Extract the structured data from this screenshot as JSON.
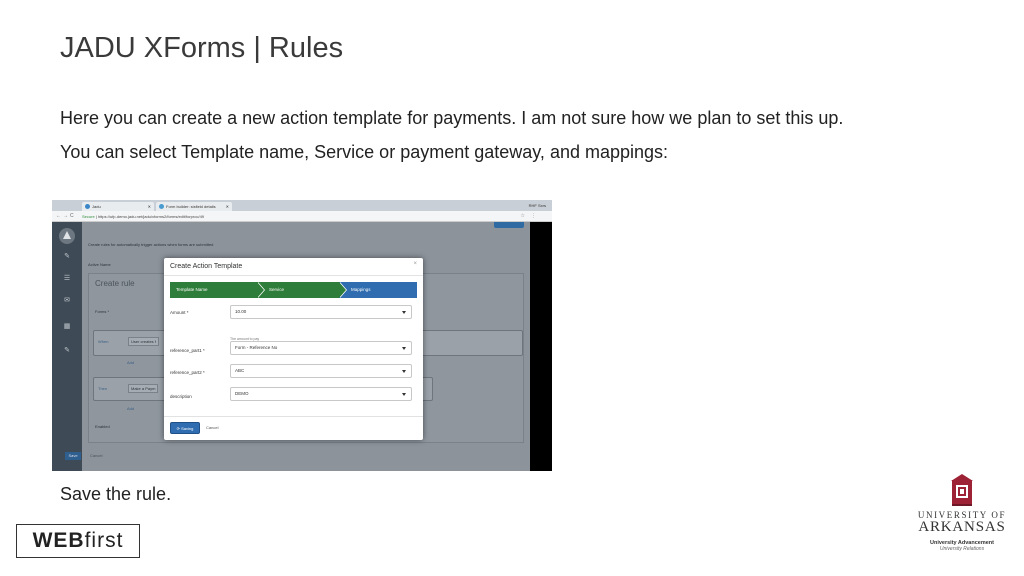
{
  "slide": {
    "title": "JADU XForms | Rules",
    "line1": "Here you can create a new action template for payments. I am not sure how we plan to set this up.",
    "line2": "You can select Template name, Service or payment gateway, and mappings:",
    "save_text": "Save the rule."
  },
  "branding": {
    "webfirst_bold": "WEB",
    "webfirst_light": "first",
    "ua_university": "UNIVERSITY OF",
    "ua_arkansas": "ARKANSAS",
    "ua_sub1": "University Advancement",
    "ua_sub2": "University Relations",
    "accent_red": "#9d2235"
  },
  "browser": {
    "tabs": [
      {
        "label": "Jadu",
        "favicon_color": "#3a86c8"
      },
      {
        "label": "Form builder: sisfield details",
        "favicon_color": "#4a9bd0"
      }
    ],
    "user": "RHF Sxrs",
    "secure_label": "Secure",
    "url": "https://ufp-demo.jadu.net/jadu/xforms2/forms/edit/forproc/49"
  },
  "app": {
    "description": "Create rules for automatically trigger actions when forms are submitted",
    "tabs": "Active   Name",
    "create_rule": "Create rule",
    "forms_label": "Forms *",
    "when_label": "When",
    "when_value": "User creates f",
    "add1": "Add",
    "then_label": "Then",
    "then_value": "Make a Paym",
    "add2": "Add",
    "enabled_label": "Enabled",
    "save": "Save",
    "cancel": "Cancel"
  },
  "modal": {
    "title": "Create Action Template",
    "close": "×",
    "steps": [
      "Template Name",
      "Service",
      "Mappings"
    ],
    "fields": [
      {
        "label": "Amount *",
        "value": "10.00"
      },
      {
        "label": "reference_part1 *",
        "value": "Form - Reference No"
      },
      {
        "label": "reference_part2 *",
        "value": "ABC"
      },
      {
        "label": "description",
        "value": "DEMO"
      }
    ],
    "amount_help": "The amount to pay",
    "saving_label": "⟳ Saving",
    "cancel_label": "Cancel"
  }
}
